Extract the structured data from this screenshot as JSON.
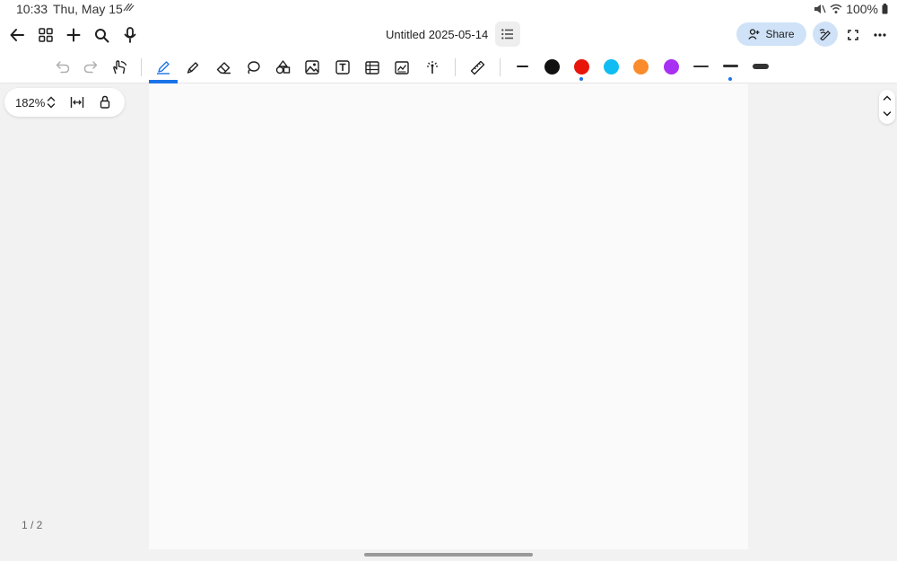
{
  "status": {
    "time": "10:33",
    "date": "Thu, May 15",
    "battery": "100%"
  },
  "appbar": {
    "title": "Untitled 2025-05-14",
    "share_label": "Share",
    "icons": [
      "back-arrow-icon",
      "grid-icon",
      "plus-icon",
      "search-icon",
      "mic-icon",
      "list-icon",
      "add-person-icon",
      "pen-ai-icon",
      "fullscreen-icon",
      "more-icon"
    ]
  },
  "toolbar": {
    "tools": [
      "undo",
      "redo",
      "hand-touch",
      "pen",
      "highlighter",
      "eraser",
      "lasso",
      "shapes",
      "image",
      "text-box",
      "table",
      "chart",
      "laser-pointer",
      "ruler"
    ],
    "active_tool": "pen",
    "colors": [
      "#111111",
      "#e8150b",
      "#0fbdf2",
      "#fb8c2b",
      "#a830f3"
    ],
    "selected_color": "#e8150b",
    "selected_stroke": "medium"
  },
  "zoom": {
    "level": "182%"
  },
  "page_counter": "1 / 2"
}
